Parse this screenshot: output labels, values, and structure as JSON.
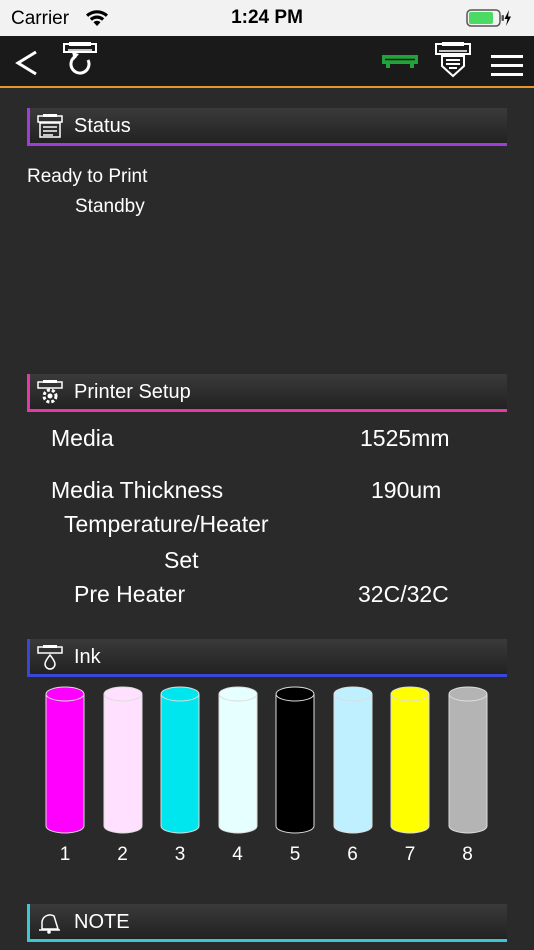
{
  "statusbar": {
    "carrier": "Carrier",
    "time": "1:24 PM",
    "battery_color": "#4cd964"
  },
  "navbar": {
    "back_icon": "chevron-left-icon",
    "reload_icon": "printer-reload-icon",
    "printer_status_color": "#22a33a",
    "printer_down_icon": "printer-download-icon",
    "menu_icon": "hamburger-menu-icon",
    "accent_color": "#e8962a"
  },
  "sections": {
    "status": {
      "title": "Status",
      "line1": "Ready to Print",
      "line2": "Standby"
    },
    "printer_setup": {
      "title": "Printer Setup",
      "media_label": "Media",
      "media_value": "1525mm",
      "thickness_label": "Media Thickness",
      "thickness_value": "190um",
      "temperature_label": "Temperature/Heater",
      "temperature_sub": "Set",
      "preheater_label": "Pre Heater",
      "preheater_value": "32C/32C"
    },
    "ink": {
      "title": "Ink",
      "cartridges": [
        {
          "label": "1",
          "color": "#ff00ff",
          "level": 1.0
        },
        {
          "label": "2",
          "color": "#ffe0ff",
          "level": 1.0
        },
        {
          "label": "3",
          "color": "#00e6ee",
          "level": 1.0
        },
        {
          "label": "4",
          "color": "#e6ffff",
          "level": 1.0
        },
        {
          "label": "5",
          "color": "#000000",
          "level": 1.0
        },
        {
          "label": "6",
          "color": "#bff0ff",
          "level": 1.0
        },
        {
          "label": "7",
          "color": "#ffff00",
          "level": 1.0
        },
        {
          "label": "8",
          "color": "#b4b4b4",
          "level": 1.0
        }
      ]
    },
    "note": {
      "title": "NOTE"
    }
  }
}
